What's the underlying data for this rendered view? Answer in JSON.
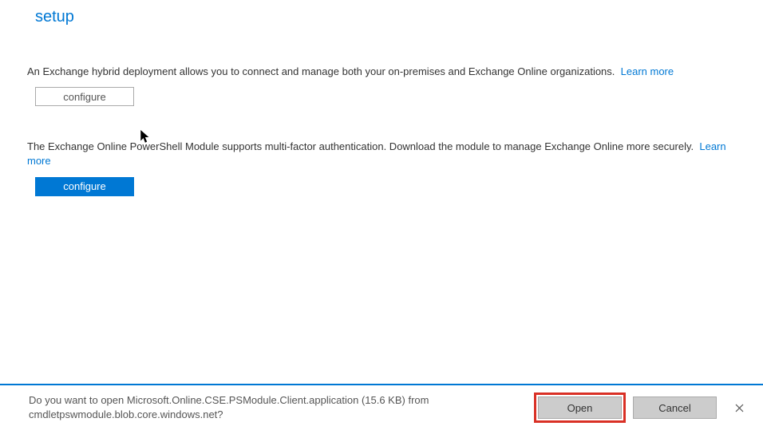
{
  "page": {
    "title": "setup"
  },
  "sections": {
    "hybrid": {
      "text": "An Exchange hybrid deployment allows you to connect and manage both your on-premises and Exchange Online organizations.",
      "learnMore": "Learn more",
      "button": "configure"
    },
    "powershell": {
      "text": "The Exchange Online PowerShell Module supports multi-factor authentication. Download the module to manage Exchange Online more securely.",
      "learnMore": "Learn more",
      "button": "configure"
    }
  },
  "downloadBar": {
    "textLine1": "Do you want to open Microsoft.Online.CSE.PSModule.Client.application (15.6 KB) from",
    "textLine2": "cmdletpswmodule.blob.core.windows.net?",
    "openLabel": "Open",
    "cancelLabel": "Cancel"
  }
}
